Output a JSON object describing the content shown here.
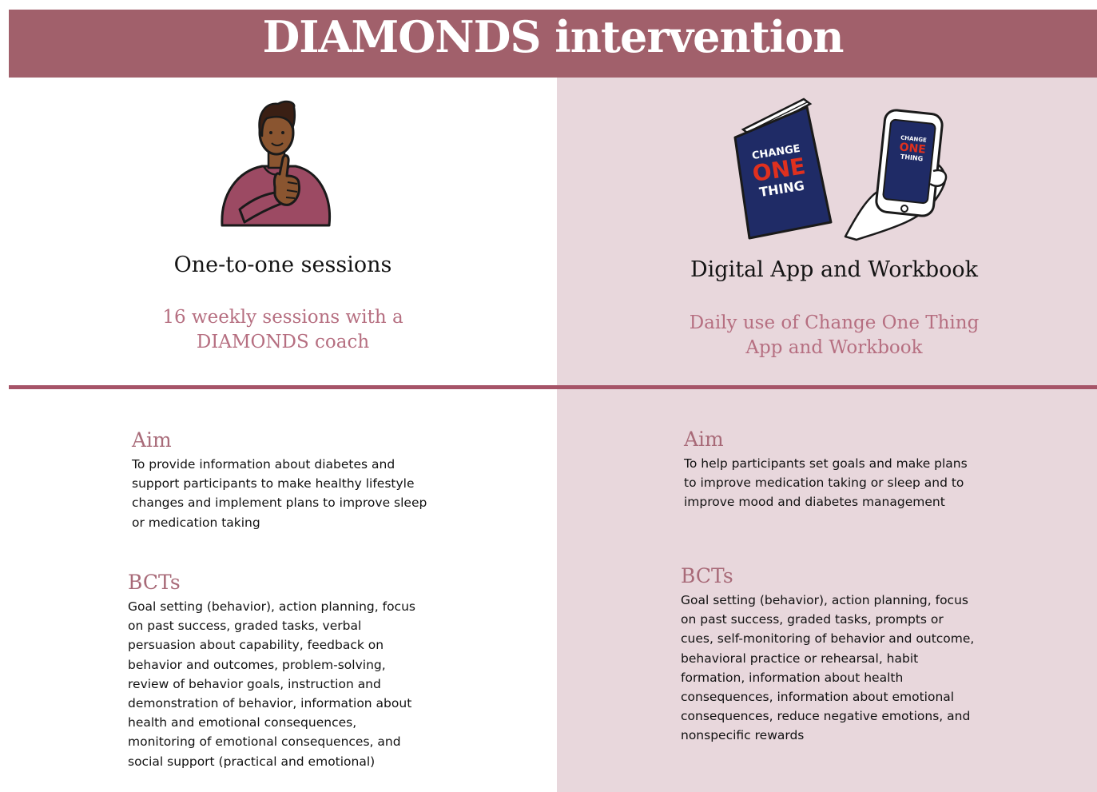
{
  "header": {
    "title": "DIAMONDS intervention"
  },
  "left": {
    "title": "One-to-one sessions",
    "subtitle_line1": "16 weekly sessions with a",
    "subtitle_line2": "DIAMONDS coach",
    "aim_heading": "Aim",
    "aim_text": "To provide information about diabetes and support participants to make healthy lifestyle changes and implement plans to improve sleep or medication taking",
    "bcts_heading": "BCTs",
    "bcts_text": "Goal setting (behavior), action planning, focus on past success, graded tasks, verbal persuasion about capability, feedback on behavior and outcomes, problem-solving, review of behavior goals, instruction and demonstration of behavior, information about health and emotional consequences, monitoring of emotional consequences, and social support (practical and emotional)"
  },
  "right": {
    "title": "Digital App and Workbook",
    "subtitle_line1": "Daily use of Change One Thing",
    "subtitle_line2": "App and Workbook",
    "aim_heading": "Aim",
    "aim_text": "To help participants set goals and make plans to improve medication taking or sleep and to improve mood and diabetes management",
    "bcts_heading": "BCTs",
    "bcts_text": "Goal setting (behavior), action planning, focus on past success, graded tasks, prompts or cues, self-monitoring of behavior and outcome, behavioral practice or rehearsal, habit formation, information about health consequences, information about emotional consequences, reduce negative emotions, and nonspecific rewards"
  },
  "book_label": {
    "line1": "CHANGE",
    "line2": "ONE",
    "line3": "THING"
  },
  "icons": {
    "person": "person-thumbs-up-icon",
    "book": "workbook-icon",
    "phone": "phone-in-hand-icon"
  },
  "colors": {
    "banner": "#a1606b",
    "right_panel": "#e8d7dc",
    "divider": "#a65468",
    "subtitle": "#b66f81",
    "heading": "#a86a78",
    "book_navy": "#1f2b66",
    "book_red": "#e0301e",
    "shirt": "#9c4a63"
  }
}
